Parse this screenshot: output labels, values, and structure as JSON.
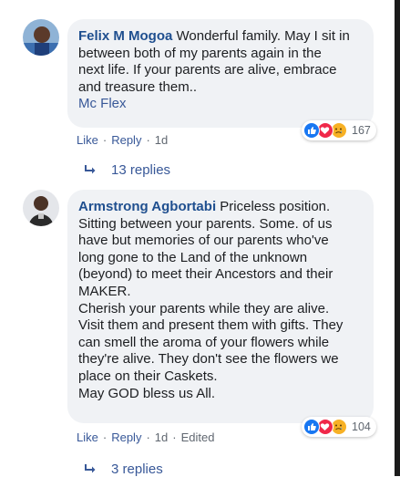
{
  "comments": [
    {
      "author": "Felix M Mogoa",
      "text": "Wonderful family. May I sit in\nbetween both of my parents again in the\nnext life. If your parents are alive, embrace\nand treasure them..",
      "tag": "Mc Flex",
      "reaction_icons": [
        "like-icon",
        "love-icon",
        "sad-icon"
      ],
      "reaction_count": "167",
      "actions": {
        "like": "Like",
        "reply": "Reply",
        "time": "1d",
        "edited": ""
      },
      "replies": "13 replies"
    },
    {
      "author": "Armstrong Agbortabi",
      "text": "Priceless position.\nSitting between your parents. Some. of us\nhave but memories of our parents who've\nlong gone to the Land of the unknown\n(beyond) to meet their Ancestors and their\nMAKER.\nCherish your parents while they are alive.\nVisit them and present them with gifts. They\ncan smell the aroma of your flowers while\nthey're alive. They don't see the flowers we\nplace on their Caskets.\nMay GOD bless us All.",
      "tag": "",
      "reaction_icons": [
        "like-icon",
        "love-icon",
        "sad-icon"
      ],
      "reaction_count": "104",
      "actions": {
        "like": "Like",
        "reply": "Reply",
        "time": "1d",
        "edited": "Edited"
      },
      "replies": "3 replies"
    }
  ],
  "colors": {
    "bubble": "#f0f2f5",
    "author": "#1f4f8f",
    "link": "#385898",
    "muted": "#606770",
    "like": "#1877f2",
    "love": "#f02849",
    "sad": "#f7b125"
  }
}
